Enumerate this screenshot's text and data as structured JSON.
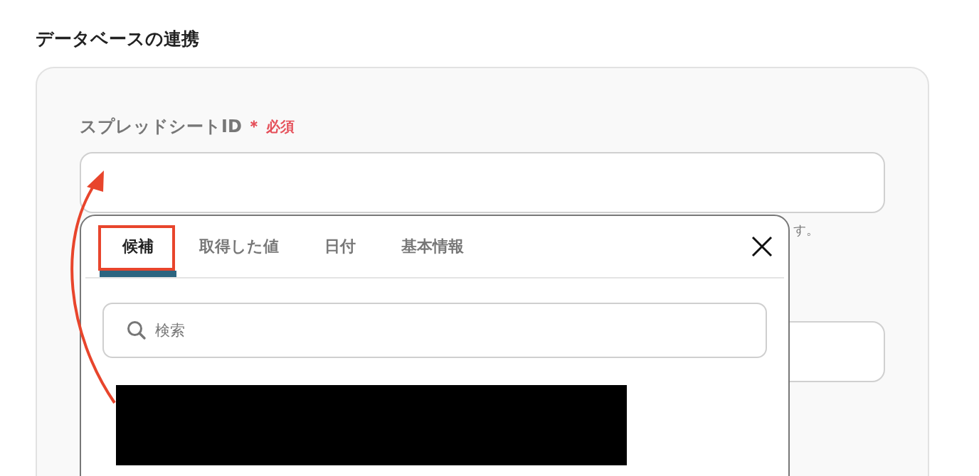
{
  "section_title": "データベースの連携",
  "field": {
    "label": "スプレッドシートID",
    "required_mark": "＊",
    "required_text": "必須",
    "hint": "す。"
  },
  "popup": {
    "tabs": [
      {
        "label": "候補",
        "selected": true
      },
      {
        "label": "取得した値",
        "selected": false
      },
      {
        "label": "日付",
        "selected": false
      },
      {
        "label": "基本情報",
        "selected": false
      }
    ],
    "search": {
      "placeholder": "検索"
    }
  }
}
